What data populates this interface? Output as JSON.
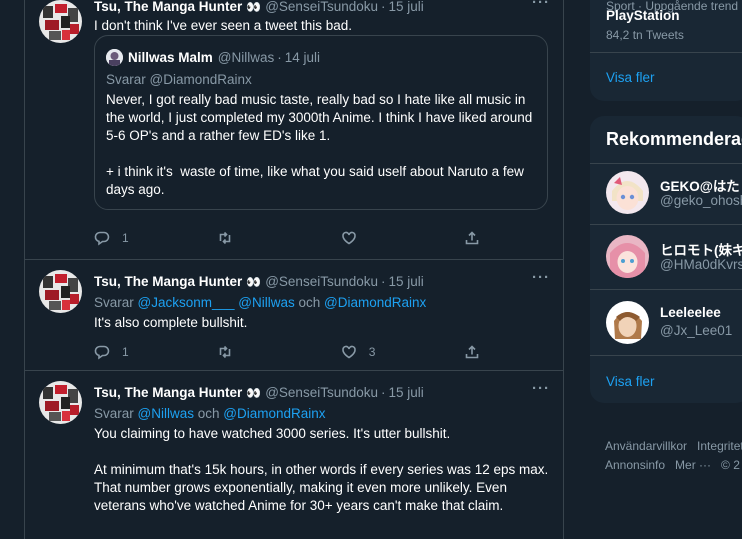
{
  "tweets": [
    {
      "author": "Tsu, The Manga Hunter",
      "emoji": "👀",
      "handle": "@SenseiTsundoku",
      "dot": "·",
      "date": "15 juli",
      "text": "I don't think I've ever seen a tweet this bad.",
      "quote": {
        "author": "Nillwas Malm",
        "handle": "@Nillwas",
        "date": "14 juli",
        "reply_prefix": "Svarar ",
        "reply_to": "@DiamondRainx",
        "text": "Never, I got really bad music taste, really bad so I hate like all music in the world, I just completed my 3000th Anime. I think I have liked around 5-6 OP's and a rather few ED's like 1.\n\n+ i think it's  waste of time, like what you said uself about Naruto a few days ago."
      },
      "replies": "1",
      "retweets": "",
      "likes": ""
    },
    {
      "author": "Tsu, The Manga Hunter",
      "emoji": "👀",
      "handle": "@SenseiTsundoku",
      "dot": "·",
      "date": "15 juli",
      "reply_prefix": "Svarar ",
      "reply_to_1": "@Jacksonm___",
      "reply_to_2": "@Nillwas",
      "reply_and": " och ",
      "reply_to_3": "@DiamondRainx",
      "text": "It's also complete bullshit.",
      "replies": "1",
      "retweets": "",
      "likes": "3"
    },
    {
      "author": "Tsu, The Manga Hunter",
      "emoji": "👀",
      "handle": "@SenseiTsundoku",
      "dot": "·",
      "date": "15 juli",
      "reply_prefix": "Svarar ",
      "reply_to_1": "@Nillwas",
      "reply_and": " och ",
      "reply_to_2": "@DiamondRainx",
      "text": "You claiming to have watched 3000 series. It's utter bullshit.\n\nAt minimum that's 15k hours, in other words if every series was 12 eps max. That number grows exponentially, making it even more unlikely. Even veterans who've watched Anime for 30+ years can't make that claim."
    }
  ],
  "more_glyph": "···",
  "sidebar": {
    "trend": {
      "subtitle": "Sport · Uppgående trend",
      "name": "PlayStation",
      "count": "84,2 tn Tweets",
      "show_more": "Visa fler"
    },
    "recommend": {
      "title": "Rekommenderade",
      "users": [
        {
          "name": "GEKO@はたく",
          "handle": "@geko_ohoshi"
        },
        {
          "name": "ヒロモト(妹キ",
          "handle": "@HMa0dKvrs"
        },
        {
          "name": "Leeleelee",
          "handle": "@Jx_Lee01"
        }
      ],
      "show_more": "Visa fler"
    },
    "footer": {
      "terms": "Användarvillkor",
      "privacy": "Integritet",
      "ads": "Annonsinfo",
      "more": "Mer ···",
      "copyright": "© 2"
    }
  },
  "colors": {
    "background": "#15202b",
    "panel": "#192734",
    "accent": "#1da1f2",
    "muted": "#8899a6",
    "border": "#38444d"
  }
}
